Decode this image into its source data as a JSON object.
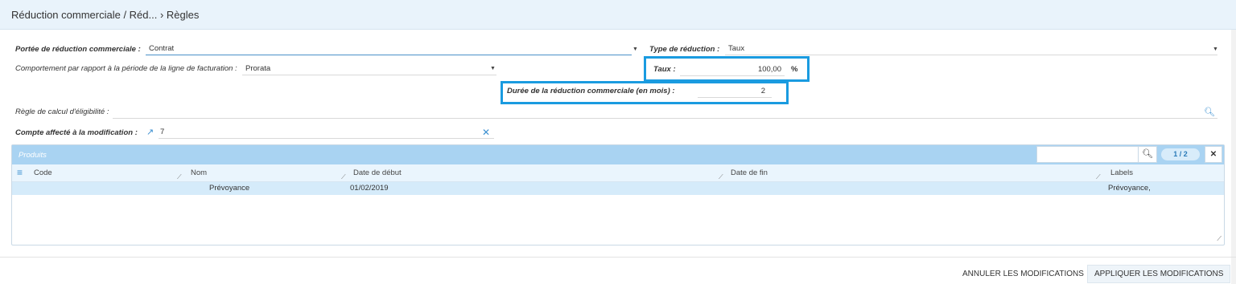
{
  "header": {
    "breadcrumb": "Réduction commerciale / Réd... › Règles"
  },
  "form": {
    "scope_label": "Portée de réduction commerciale :",
    "scope_value": "Contrat",
    "type_label": "Type de réduction :",
    "type_value": "Taux",
    "behavior_label": "Comportement par rapport à la période de la ligne de facturation :",
    "behavior_value": "Prorata",
    "rate_label": "Taux :",
    "rate_value": "100,00",
    "rate_unit": "%",
    "duration_label": "Durée de la réduction commerciale (en mois) :",
    "duration_value": "2",
    "eligibility_label": "Règle de calcul d'éligibilité :",
    "eligibility_value": "",
    "account_label": "Compte affecté à la modification :",
    "account_value": "7"
  },
  "grid": {
    "title": "Produits",
    "search_value": "",
    "pager": "1 / 2",
    "columns": [
      "Code",
      "Nom",
      "Date de début",
      "Date de fin",
      "Labels"
    ],
    "rows": [
      {
        "code": "",
        "nom": "Prévoyance",
        "date_debut": "01/02/2019",
        "date_fin": "",
        "labels": "Prévoyance,"
      }
    ]
  },
  "footer": {
    "cancel_label": "ANNULER LES MODIFICATIONS",
    "apply_label": "APPLIQUER LES MODIFICATIONS"
  },
  "colors": {
    "header_bg": "#e9f3fb",
    "highlight": "#1a9be0",
    "grid_header": "#a9d3f2",
    "selected_row": "#d5ebfa"
  }
}
